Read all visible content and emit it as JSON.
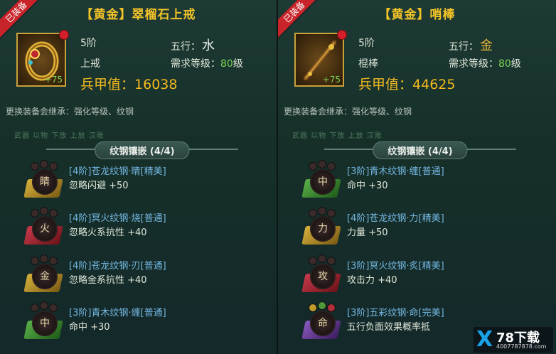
{
  "left": {
    "badge": "已装备",
    "title": "【黄金】翠榴石上戒",
    "stage": "5阶",
    "wuxing_label": "五行：",
    "wuxing_char": "水",
    "type": "上戒",
    "req_label": "需求等级：",
    "req_level": "80",
    "req_suffix": "级",
    "enhance": "+75",
    "power_label": "兵甲值：",
    "power": "16038",
    "inherit": "更换装备会继承：强化等级、纹钢",
    "faded": "武器 以物 下放 上放 汉账",
    "section": "纹钢镶嵌 (4/4)",
    "gems": [
      {
        "char": "睛",
        "name": "[4阶]苍龙纹钢·睛[精美]",
        "attr": "忽略闪避  +50",
        "color": "#c09b2c"
      },
      {
        "char": "火",
        "name": "[4阶]冥火纹钢·烧[普通]",
        "attr": "忽略火系抗性  +40",
        "color": "#b0303a"
      },
      {
        "char": "金",
        "name": "[4阶]苍龙纹钢·刃[普通]",
        "attr": "忽略金系抗性  +40",
        "color": "#c09b2c"
      },
      {
        "char": "中",
        "name": "[3阶]青木纹钢·缠[普通]",
        "attr": "命中  +30",
        "color": "#4e9a3a"
      }
    ]
  },
  "right": {
    "badge": "已装备",
    "title": "【黄金】哨棒",
    "stage": "5阶",
    "wuxing_label": "五行：",
    "wuxing_char": "金",
    "type": "棍棒",
    "req_label": "需求等级：",
    "req_level": "80",
    "req_suffix": "级",
    "enhance": "+75",
    "power_label": "兵甲值：",
    "power": "44625",
    "inherit": "更换装备会继承：强化等级、纹钢",
    "faded": "武器 以物 下放 上放 汉账",
    "section": "纹钢镶嵌 (4/4)",
    "gems": [
      {
        "char": "中",
        "name": "[3阶]青木纹钢·缠[普通]",
        "attr": "命中  +30",
        "color": "#4e9a3a"
      },
      {
        "char": "力",
        "name": "[4阶]苍龙纹钢·力[精美]",
        "attr": "力量  +50",
        "color": "#c09b2c"
      },
      {
        "char": "攻",
        "name": "[3阶]冥火纹钢·炙[精美]",
        "attr": "攻击力  +40",
        "color": "#b0303a"
      },
      {
        "char": "命",
        "name": "[3阶]五彩纹钢·命[完美]",
        "attr": "五行负面效果概率抵",
        "color": "#7a4aa8"
      }
    ]
  },
  "watermark": {
    "x": "X",
    "text": "78下载",
    "url": "4007787878.com"
  }
}
